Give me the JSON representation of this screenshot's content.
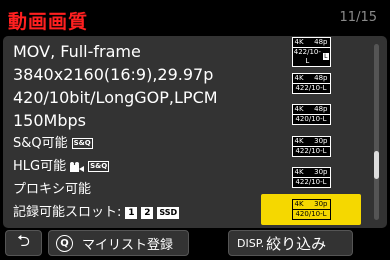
{
  "header": {
    "title": "動画画質",
    "page": "11/15"
  },
  "info": {
    "format": "MOV, Full-frame",
    "resolution": "3840x2160(16:9),29.97p",
    "codec": "420/10bit/LongGOP,LPCM",
    "bitrate": "150Mbps",
    "sq": "S&Q可能",
    "sq_icon": "S&Q",
    "hlg": "HLG可能",
    "hlg_icon": "S&Q",
    "proxy": "プロキシ可能",
    "slot_label": "記録可能スロット:",
    "slot1": "1",
    "slot2": "2",
    "slot_ssd": "SSD"
  },
  "quality_list": [
    {
      "res": "4K",
      "fps": "48p",
      "spec": "422/10-L",
      "tag": "L"
    },
    {
      "res": "4K",
      "fps": "48p",
      "spec": "422/10-L"
    },
    {
      "res": "4K",
      "fps": "48p",
      "spec": "420/10-L"
    },
    {
      "res": "4K",
      "fps": "30p",
      "spec": "422/10-L"
    },
    {
      "res": "4K",
      "fps": "30p",
      "spec": "422/10-L"
    },
    {
      "res": "4K",
      "fps": "30p",
      "spec": "420/10-L"
    }
  ],
  "selected_index": 5,
  "scrollbar_position": 0.72,
  "footer": {
    "back_icon": "return-icon",
    "q_icon": "Q",
    "mylist": "マイリスト登録",
    "disp_key": "DISP.",
    "disp": "絞り込み"
  },
  "colors": {
    "title": "#ff2020",
    "selected": "#f5d800"
  }
}
